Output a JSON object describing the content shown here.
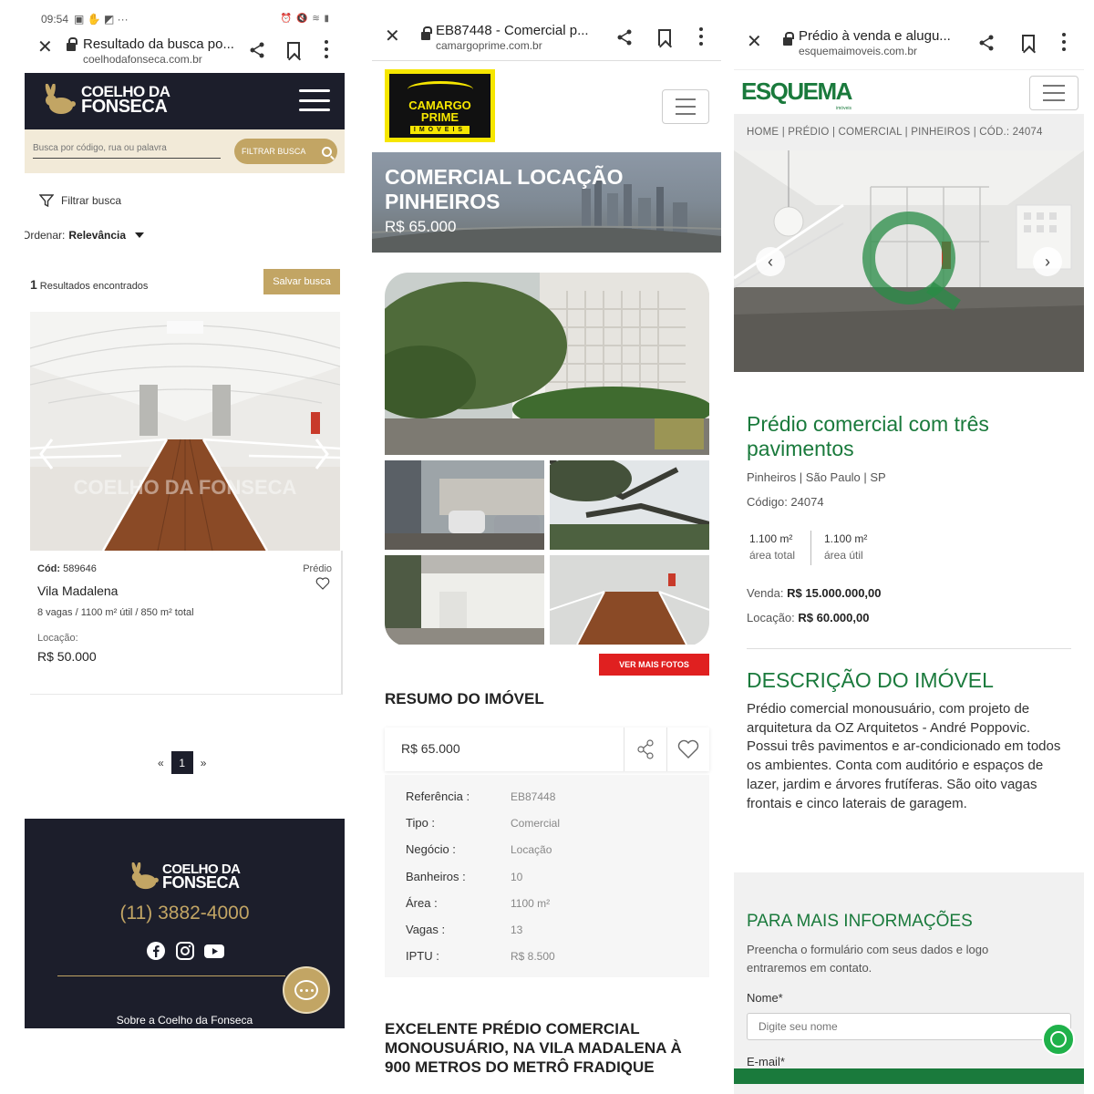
{
  "panel1": {
    "status": {
      "time": "09:54",
      "icons": "▣ ✋ ◩ ···",
      "right": "⏰ 🔇 ≋ ▮"
    },
    "browser": {
      "title": "Resultado da busca po...",
      "host": "coelhodafonseca.com.br"
    },
    "logo": {
      "line1": "COELHO DA",
      "line2": "FONSECA"
    },
    "search": {
      "placeholder": "Busca por código, rua ou palavra",
      "button": "FILTRAR BUSCA"
    },
    "filter_label": "Filtrar busca",
    "sort": {
      "label": "Ordenar:",
      "value": "Relevância"
    },
    "results": {
      "count": "1",
      "label": "Resultados encontrados",
      "save": "Salvar busca"
    },
    "photo_watermark": "COELHO DA FONSECA",
    "card": {
      "cod_label": "Cód:",
      "cod": "589646",
      "tipo": "Prédio",
      "bairro": "Vila Madalena",
      "desc": "8 vagas / 1100 m² útil / 850 m² total",
      "loc_label": "Locação:",
      "loc_value": "R$ 50.000"
    },
    "pager": {
      "prev": "«",
      "current": "1",
      "next": "»"
    },
    "footer": {
      "phone": "(11) 3882-4000",
      "about": "Sobre a Coelho da Fonseca"
    }
  },
  "panel2": {
    "browser": {
      "title": "EB87448 - Comercial p...",
      "host": "camargoprime.com.br"
    },
    "logo": {
      "line1": "CAMARGO",
      "line2": "PRIME",
      "line3": "IMÓVEIS"
    },
    "hero": {
      "title": "COMERCIAL LOCAÇÃO PINHEIROS",
      "price": "R$ 65.000"
    },
    "more_photos": "VER MAIS FOTOS",
    "resumo": "RESUMO DO IMÓVEL",
    "price": "R$ 65.000",
    "details": [
      {
        "label": "Referência :",
        "value": "EB87448"
      },
      {
        "label": "Tipo :",
        "value": "Comercial"
      },
      {
        "label": "Negócio :",
        "value": "Locação"
      },
      {
        "label": "Banheiros :",
        "value": "10"
      },
      {
        "label": "Área :",
        "value": "1100 m²"
      },
      {
        "label": "Vagas :",
        "value": "13"
      },
      {
        "label": "IPTU :",
        "value": "R$ 8.500"
      }
    ],
    "headline": "EXCELENTE PRÉDIO COMERCIAL MONOUSUÁRIO, NA VILA MADALENA À 900 METROS DO METRÔ FRADIQUE"
  },
  "panel3": {
    "browser": {
      "title": "Prédio à venda e alugu...",
      "host": "esquemaimoveis.com.br"
    },
    "logo": {
      "text": "ESQUEMA",
      "sub": "imóveis"
    },
    "breadcrumb": "HOME | PRÉDIO | COMERCIAL | PINHEIROS | CÓD.: 24074",
    "title": "Prédio comercial com três pavimentos",
    "location": "Pinheiros | São Paulo | SP",
    "code": "Código: 24074",
    "area_total": {
      "value": "1.100 m²",
      "label": "área total"
    },
    "area_util": {
      "value": "1.100 m²",
      "label": "área útil"
    },
    "venda": {
      "label": "Venda:",
      "value": "R$ 15.000.000,00"
    },
    "locacao": {
      "label": "Locação:",
      "value": "R$ 60.000,00"
    },
    "desc_title": "DESCRIÇÃO DO IMÓVEL",
    "desc": "Prédio comercial monousuário, com projeto de arquitetura da OZ Arquitetos - André Poppovic. Possui três pavimentos e ar-condicionado em todos os ambientes. Conta com auditório e espaços de lazer, jardim e árvores frutíferas. São oito vagas frontais e cinco laterais de garagem.",
    "info_title": "PARA MAIS INFORMAÇÕES",
    "info_sub": "Preencha o formulário com seus dados e logo entraremos em contato.",
    "nome_label": "Nome*",
    "nome_placeholder": "Digite seu nome",
    "email_label": "E-mail*"
  },
  "colors": {
    "cf_navy": "#1c1e2b",
    "cf_gold": "#c2a564",
    "cp_yellow": "#f6e600",
    "cp_red": "#e02020",
    "es_green": "#1a7a3c"
  }
}
